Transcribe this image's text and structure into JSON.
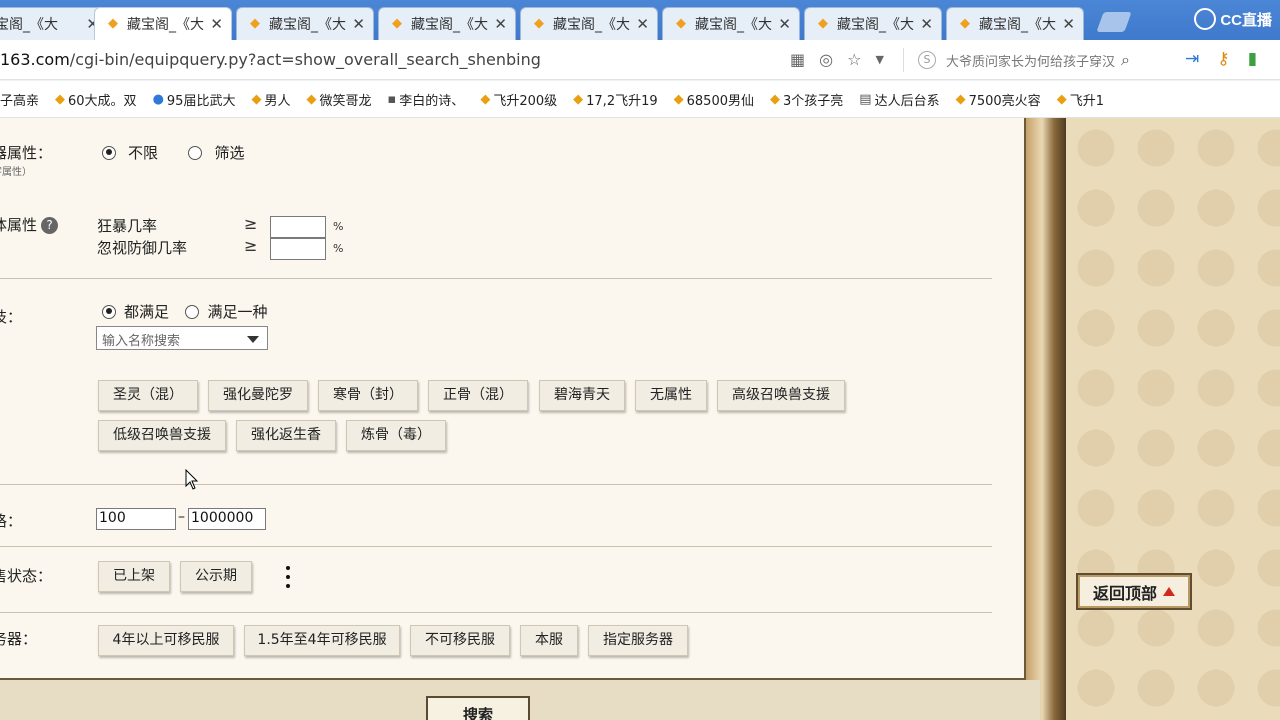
{
  "browser": {
    "tabs": [
      {
        "title": "藏宝阁_《大",
        "active": false
      },
      {
        "title": "藏宝阁_《大",
        "active": true
      },
      {
        "title": "藏宝阁_《大",
        "active": false
      },
      {
        "title": "藏宝阁_《大",
        "active": false
      },
      {
        "title": "藏宝阁_《大",
        "active": false
      },
      {
        "title": "藏宝阁_《大",
        "active": false
      },
      {
        "title": "藏宝阁_《大",
        "active": false
      },
      {
        "title": "藏宝阁_《大",
        "active": false
      }
    ],
    "brand": "CC直播",
    "url_host": "163.com",
    "url_path": "/cgi-bin/equipquery.py?act=show_overall_search_shenbing",
    "search_text": "大爷质问家长为何给孩子穿汉",
    "bookmarks": [
      {
        "label": "子高亲",
        "icon": "chick-icon"
      },
      {
        "label": "60大成。双",
        "icon": "chick-icon"
      },
      {
        "label": "95届比武大",
        "icon": "ie-icon"
      },
      {
        "label": "男人",
        "icon": "chick-icon"
      },
      {
        "label": "微笑哥龙",
        "icon": "chick-icon"
      },
      {
        "label": "李白的诗、",
        "icon": "site-icon"
      },
      {
        "label": "飞升200级",
        "icon": "chick-icon"
      },
      {
        "label": "17,2飞升19",
        "icon": "chick-icon"
      },
      {
        "label": "68500男仙",
        "icon": "chick-icon"
      },
      {
        "label": "3个孩子亮",
        "icon": "chick-icon"
      },
      {
        "label": "达人后台系",
        "icon": "doc-icon"
      },
      {
        "label": "7500亮火容",
        "icon": "chick-icon"
      },
      {
        "label": "飞升1",
        "icon": "chick-icon"
      }
    ]
  },
  "form": {
    "weapon_attr": {
      "label": "器属性：",
      "sub": "字属性）",
      "opt_all": "不限",
      "opt_filter": "筛选"
    },
    "special_attr": {
      "label": "体属性",
      "help": "?",
      "fields": [
        {
          "name": "狂暴几率",
          "op": "≥",
          "unit": "%"
        },
        {
          "name": "忽视防御几率",
          "op": "≥",
          "unit": "%"
        }
      ]
    },
    "skills": {
      "label": "技：",
      "opt_all": "都满足",
      "opt_any": "满足一种",
      "search_placeholder": "输入名称搜索",
      "chips": [
        "圣灵（混）",
        "强化曼陀罗",
        "寒骨（封）",
        "正骨（混）",
        "碧海青天",
        "无属性",
        "高级召唤兽支援",
        "低级召唤兽支援",
        "强化返生香",
        "炼骨（毒）"
      ]
    },
    "price": {
      "label": "格：",
      "min": "100",
      "dash": "–",
      "max": "1000000"
    },
    "sale_status": {
      "label": "售状态：",
      "chips": [
        "已上架",
        "公示期"
      ]
    },
    "server": {
      "label": "务器：",
      "chips": [
        "4年以上可移民服",
        "1.5年至4年可移民服",
        "不可移民服",
        "本服",
        "指定服务器"
      ]
    },
    "search_button": "搜索",
    "back_to_top": "返回顶部"
  }
}
